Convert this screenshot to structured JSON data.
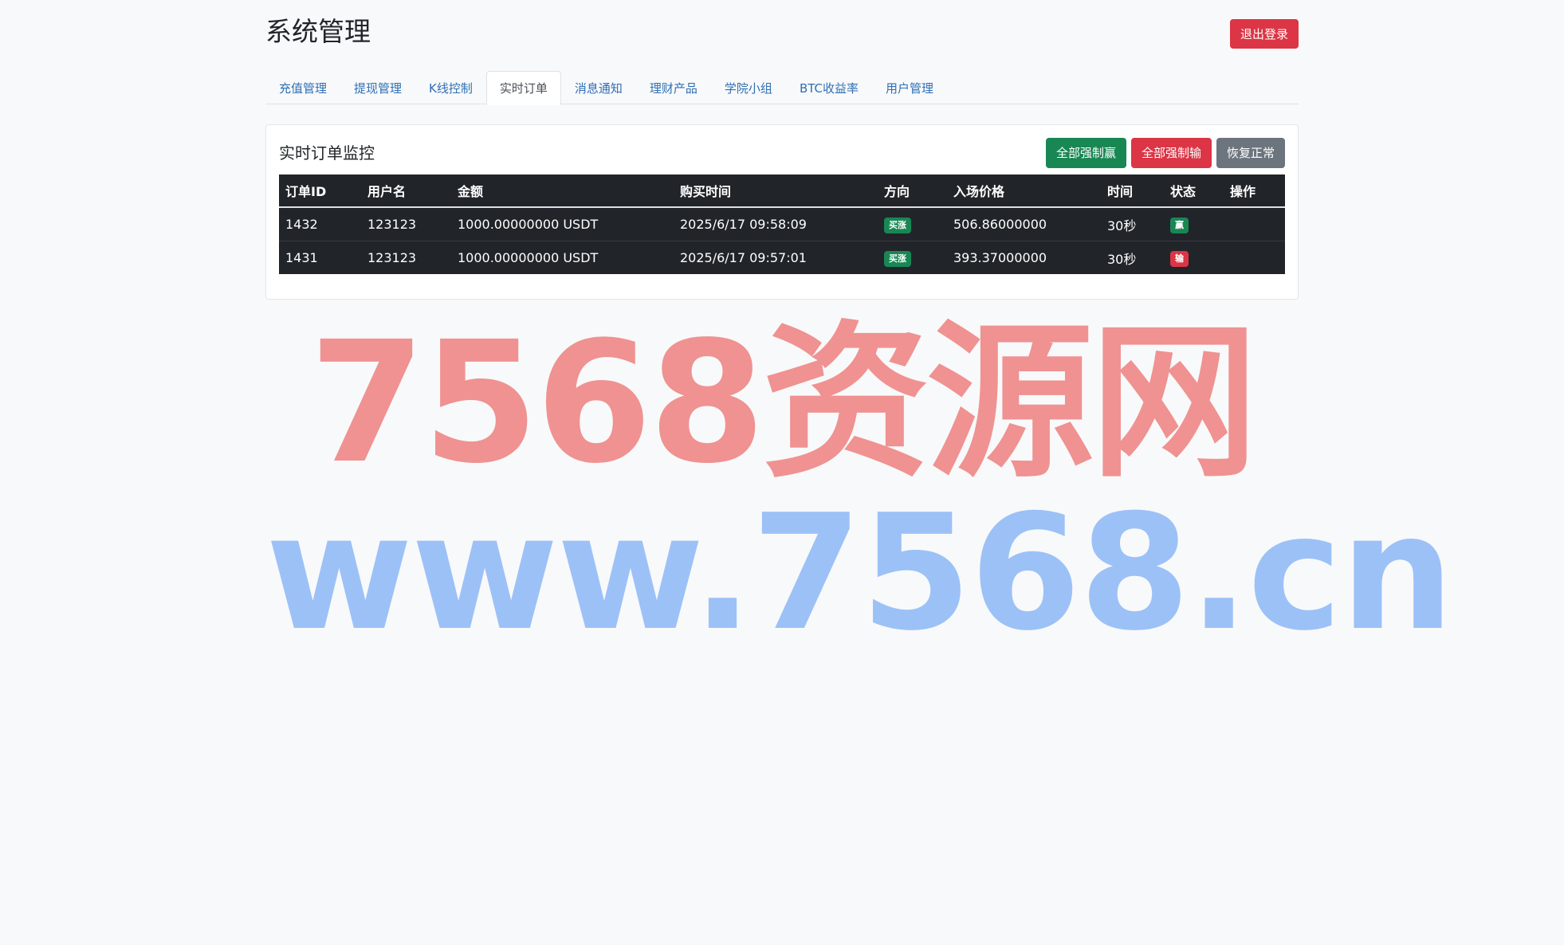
{
  "header": {
    "title": "系统管理",
    "logout_label": "退出登录"
  },
  "tabs": [
    {
      "label": "充值管理",
      "active": false
    },
    {
      "label": "提现管理",
      "active": false
    },
    {
      "label": "K线控制",
      "active": false
    },
    {
      "label": "实时订单",
      "active": true
    },
    {
      "label": "消息通知",
      "active": false
    },
    {
      "label": "理财产品",
      "active": false
    },
    {
      "label": "学院小组",
      "active": false
    },
    {
      "label": "BTC收益率",
      "active": false
    },
    {
      "label": "用户管理",
      "active": false
    }
  ],
  "card": {
    "title": "实时订单监控",
    "actions": {
      "force_win": "全部强制赢",
      "force_lose": "全部强制输",
      "restore": "恢复正常"
    }
  },
  "table": {
    "headers": [
      "订单ID",
      "用户名",
      "金额",
      "购买时间",
      "方向",
      "入场价格",
      "时间",
      "状态",
      "操作"
    ],
    "rows": [
      {
        "id": "1432",
        "username": "123123",
        "amount": "1000.00000000 USDT",
        "time": "2025/6/17 09:58:09",
        "direction": "买涨",
        "entry_price": "506.86000000",
        "duration": "30秒",
        "status": "赢",
        "status_color": "#198754",
        "action": ""
      },
      {
        "id": "1431",
        "username": "123123",
        "amount": "1000.00000000 USDT",
        "time": "2025/6/17 09:57:01",
        "direction": "买涨",
        "entry_price": "393.37000000",
        "duration": "30秒",
        "status": "输",
        "status_color": "#dc3545",
        "action": ""
      }
    ]
  },
  "watermark": {
    "line1": "7568资源网",
    "line2": "www.7568.cn"
  },
  "colors": {
    "success": "#198754",
    "danger": "#dc3545",
    "secondary": "#6c757d",
    "table_dark": "#212529"
  }
}
